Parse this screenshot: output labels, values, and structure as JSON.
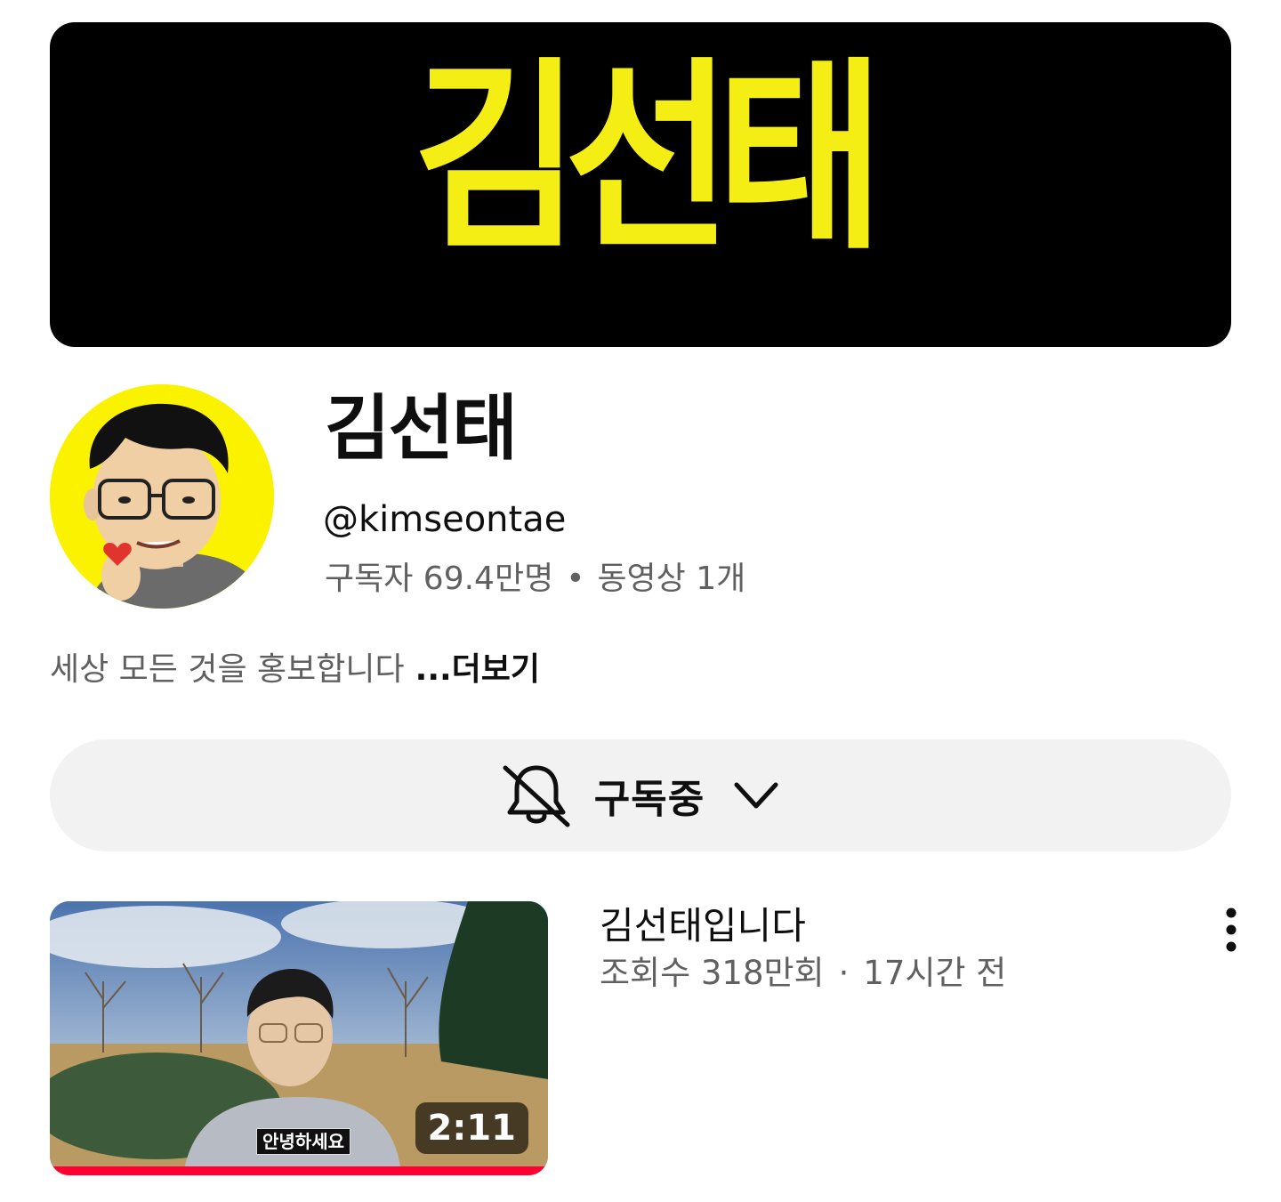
{
  "banner": {
    "logo_text": "김선태",
    "background_color": "#000000",
    "logo_color": "#f4ee14"
  },
  "channel": {
    "avatar_icon": "cartoon-portrait-avatar",
    "name": "김선태",
    "handle": "@kimseontae",
    "subscribers": "구독자 69.4만명",
    "stats_separator": "•",
    "video_count": "동영상 1개",
    "description": "세상 모든 것을 홍보합니다",
    "more_label": "...더보기"
  },
  "subscribe": {
    "bell_icon": "bell-off-icon",
    "label": "구독중",
    "chevron_icon": "chevron-down-icon",
    "background_color": "#f2f2f2"
  },
  "video": {
    "title": "김선태입니다",
    "views": "조회수 318만회",
    "separator": "·",
    "age": "17시간 전",
    "duration": "2:11",
    "thumbnail_caption": "안녕하세요",
    "watched_progress_percent": 100,
    "progress_color": "#ff0033",
    "menu_icon": "more-vertical-icon"
  }
}
